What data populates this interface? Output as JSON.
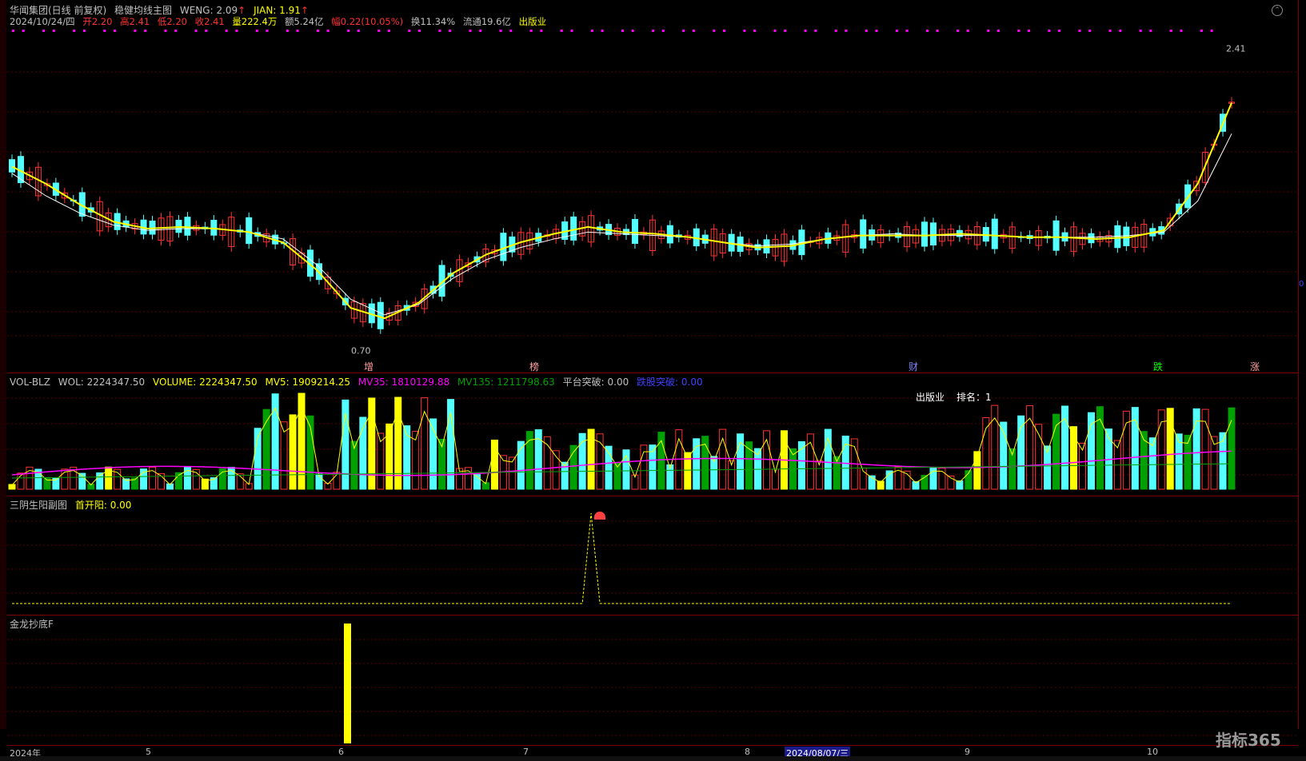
{
  "main": {
    "stock_name": "华闻集团(日线 前复权)",
    "indicator": "稳健均线主图",
    "weng_label": "WENG: 2.09",
    "jian_label": "JIAN: 1.91",
    "date": "2024/10/24/四",
    "open": "开2.20",
    "high": "高2.41",
    "low": "低2.20",
    "close": "收2.41",
    "volume": "量222.4万",
    "amount": "额5.24亿",
    "change": "幅0.22(10.05%)",
    "turnover": "换11.34%",
    "float": "流通19.6亿",
    "sector": "出版业",
    "high_price_label": "2.41",
    "low_price_label": "0.70",
    "right_mark": "0",
    "event_labels": [
      "增",
      "榜",
      "财",
      "跌",
      "涨"
    ]
  },
  "vol": {
    "title": "VOL-BLZ",
    "wol": "WOL: 2224347.50",
    "volume": "VOLUME: 2224347.50",
    "mv5": "MV5: 1909214.25",
    "mv35": "MV35: 1810129.88",
    "mv135": "MV135: 1211798.63",
    "platform": "平台突破: 0.00",
    "breakout": "跌股突破: 0.00",
    "sector": "出版业",
    "rank": "排名：1"
  },
  "sub1": {
    "title": "三阴生阳副图",
    "first_yang": "首开阳: 0.00"
  },
  "sub2": {
    "title": "金龙抄底F"
  },
  "xaxis": {
    "labels": [
      "2024年",
      "5",
      "6",
      "7",
      "8",
      "2024/08/07/三",
      "9",
      "10"
    ]
  },
  "watermark": "指标365",
  "colors": {
    "up": "#ff3232",
    "down": "#54ffff",
    "yellow": "#ffff00",
    "magenta": "#ff00ff",
    "green": "#00a000"
  },
  "chart_data": {
    "type": "candlestick",
    "series": [
      {
        "name": "WENG",
        "values": [
          1.72,
          1.62,
          1.5,
          1.4,
          1.36,
          1.37,
          1.36,
          1.34,
          1.28,
          1.12,
          0.9,
          0.84,
          0.93,
          1.1,
          1.21,
          1.28,
          1.33,
          1.37,
          1.34,
          1.33,
          1.31,
          1.28,
          1.25,
          1.26,
          1.3,
          1.32,
          1.32,
          1.32,
          1.33,
          1.32,
          1.31,
          1.31,
          1.3,
          1.31,
          1.35,
          1.62,
          2.09
        ]
      },
      {
        "name": "JIAN",
        "values": [
          1.68,
          1.55,
          1.45,
          1.38,
          1.35,
          1.36,
          1.36,
          1.34,
          1.3,
          1.15,
          0.95,
          0.86,
          0.92,
          1.07,
          1.18,
          1.25,
          1.3,
          1.34,
          1.33,
          1.32,
          1.31,
          1.28,
          1.26,
          1.27,
          1.3,
          1.32,
          1.33,
          1.32,
          1.32,
          1.32,
          1.31,
          1.31,
          1.31,
          1.32,
          1.34,
          1.52,
          1.91
        ]
      }
    ],
    "high": 2.41,
    "low": 0.7,
    "last_close": 2.41
  }
}
